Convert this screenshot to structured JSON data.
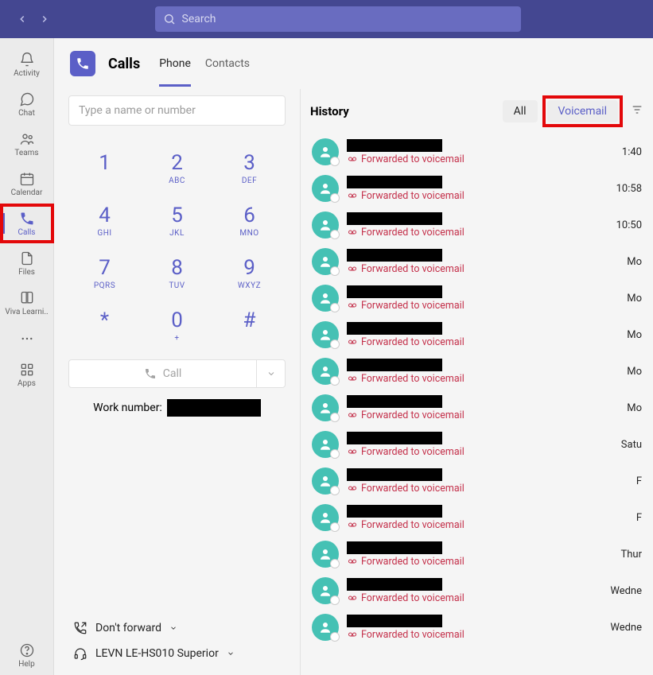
{
  "titlebar": {
    "search_placeholder": "Search"
  },
  "rail": {
    "items": [
      {
        "key": "activity",
        "label": "Activity"
      },
      {
        "key": "chat",
        "label": "Chat"
      },
      {
        "key": "teams",
        "label": "Teams"
      },
      {
        "key": "calendar",
        "label": "Calendar"
      },
      {
        "key": "calls",
        "label": "Calls",
        "active": true,
        "highlight": true
      },
      {
        "key": "files",
        "label": "Files"
      },
      {
        "key": "viva",
        "label": "Viva Learni.."
      }
    ],
    "apps_label": "Apps",
    "help_label": "Help"
  },
  "header": {
    "title": "Calls",
    "tabs": [
      {
        "key": "phone",
        "label": "Phone",
        "active": true
      },
      {
        "key": "contacts",
        "label": "Contacts"
      }
    ]
  },
  "dialer": {
    "input_placeholder": "Type a name or number",
    "keys": [
      {
        "d": "1",
        "l": ""
      },
      {
        "d": "2",
        "l": "ABC"
      },
      {
        "d": "3",
        "l": "DEF"
      },
      {
        "d": "4",
        "l": "GHI"
      },
      {
        "d": "5",
        "l": "JKL"
      },
      {
        "d": "6",
        "l": "MNO"
      },
      {
        "d": "7",
        "l": "PQRS"
      },
      {
        "d": "8",
        "l": "TUV"
      },
      {
        "d": "9",
        "l": "WXYZ"
      },
      {
        "d": "*",
        "l": ""
      },
      {
        "d": "0",
        "l": "+"
      },
      {
        "d": "#",
        "l": ""
      }
    ],
    "call_label": "Call",
    "work_label": "Work number:",
    "forward_label": "Don't forward",
    "device_label": "LEVN LE-HS010 Superior"
  },
  "history": {
    "title": "History",
    "filter_all": "All",
    "filter_vm": "Voicemail",
    "forward_text": "Forwarded to voicemail",
    "rows": [
      {
        "time": "1:40"
      },
      {
        "time": "10:58"
      },
      {
        "time": "10:50"
      },
      {
        "time": "Mo"
      },
      {
        "time": "Mo"
      },
      {
        "time": "Mo"
      },
      {
        "time": "Mo"
      },
      {
        "time": "Mo"
      },
      {
        "time": "Satu"
      },
      {
        "time": "F"
      },
      {
        "time": "F"
      },
      {
        "time": "Thur"
      },
      {
        "time": "Wedne"
      },
      {
        "time": "Wedne"
      }
    ]
  }
}
